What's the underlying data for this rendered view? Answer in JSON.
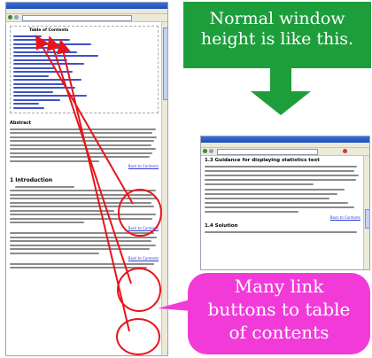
{
  "callouts": {
    "normal_window": [
      "Normal window",
      "height is like this."
    ],
    "many_links": [
      "Many link",
      "buttons to table",
      "of contents"
    ]
  },
  "small_window": {
    "section_13_heading": "1.3  Guidance for displaying statistics text",
    "back_link": "Back to Contents",
    "section_14_heading": "1.4  Solution"
  },
  "tall_window": {
    "toc_heading": "Table of Contents",
    "abstract_heading": "Abstract",
    "section_1_heading": "1  Introduction",
    "back_link_1": "Back to Contents",
    "back_link_2": "Back to Contents",
    "back_link_3": "Back to Contents"
  },
  "colors": {
    "green": "#1d9e3b",
    "pink": "#f23ad9",
    "red": "#e8141b"
  }
}
